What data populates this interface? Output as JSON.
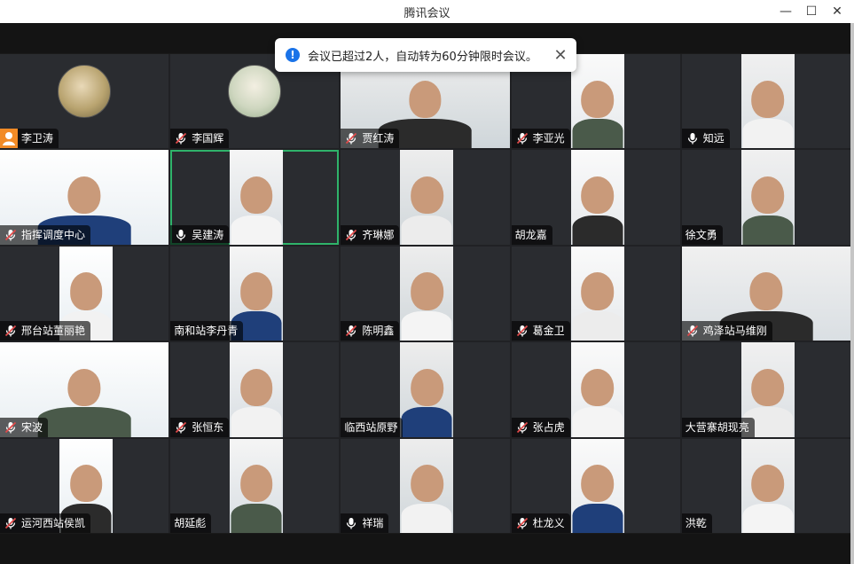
{
  "window": {
    "title": "腾讯会议",
    "minimize_label": "—",
    "maximize_label": "☐",
    "close_label": "✕"
  },
  "notification": {
    "text": "会议已超过2人，自动转为60分钟限时会议。",
    "icon": "info-icon",
    "close_label": "✕"
  },
  "colors": {
    "active_speaker_border": "#2fb36a",
    "muted_mic": "#e04a4a",
    "info_blue": "#1a73e8",
    "host_badge": "#f28b26"
  },
  "participants": [
    {
      "name": "李卫涛",
      "mic": "none",
      "badge": "avatar",
      "video": "avatar"
    },
    {
      "name": "李国辉",
      "mic": "muted",
      "video": "avatar"
    },
    {
      "name": "贾红涛",
      "mic": "muted",
      "video": "wide"
    },
    {
      "name": "李亚光",
      "mic": "muted",
      "video": "narrow"
    },
    {
      "name": "知远",
      "mic": "on",
      "video": "narrow"
    },
    {
      "name": "指挥调度中心",
      "mic": "muted",
      "video": "wide"
    },
    {
      "name": "吴建涛",
      "mic": "on",
      "video": "narrow",
      "active": true
    },
    {
      "name": "齐琳娜",
      "mic": "muted",
      "video": "narrow"
    },
    {
      "name": "胡龙嘉",
      "mic": "none",
      "video": "narrow"
    },
    {
      "name": "徐文勇",
      "mic": "none",
      "video": "narrow"
    },
    {
      "name": "邢台站董丽艳",
      "mic": "muted",
      "video": "narrow"
    },
    {
      "name": "南和站李丹青",
      "mic": "none",
      "video": "narrow"
    },
    {
      "name": "陈明鑫",
      "mic": "muted",
      "video": "narrow"
    },
    {
      "name": "葛金卫",
      "mic": "muted",
      "video": "narrow"
    },
    {
      "name": "鸡泽站马维刚",
      "mic": "muted",
      "video": "wide"
    },
    {
      "name": "宋波",
      "mic": "muted",
      "video": "wide"
    },
    {
      "name": "张恒东",
      "mic": "muted",
      "video": "narrow"
    },
    {
      "name": "临西站原野",
      "mic": "none",
      "video": "narrow"
    },
    {
      "name": "张占虎",
      "mic": "muted",
      "video": "narrow"
    },
    {
      "name": "大营寨胡现亮",
      "mic": "none",
      "video": "narrow"
    },
    {
      "name": "运河西站侯凯",
      "mic": "muted",
      "video": "narrow"
    },
    {
      "name": "胡延彪",
      "mic": "none",
      "video": "narrow"
    },
    {
      "name": "祥瑞",
      "mic": "on",
      "video": "narrow"
    },
    {
      "name": "杜龙义",
      "mic": "muted",
      "video": "narrow"
    },
    {
      "name": "洪乾",
      "mic": "none",
      "video": "narrow"
    }
  ]
}
